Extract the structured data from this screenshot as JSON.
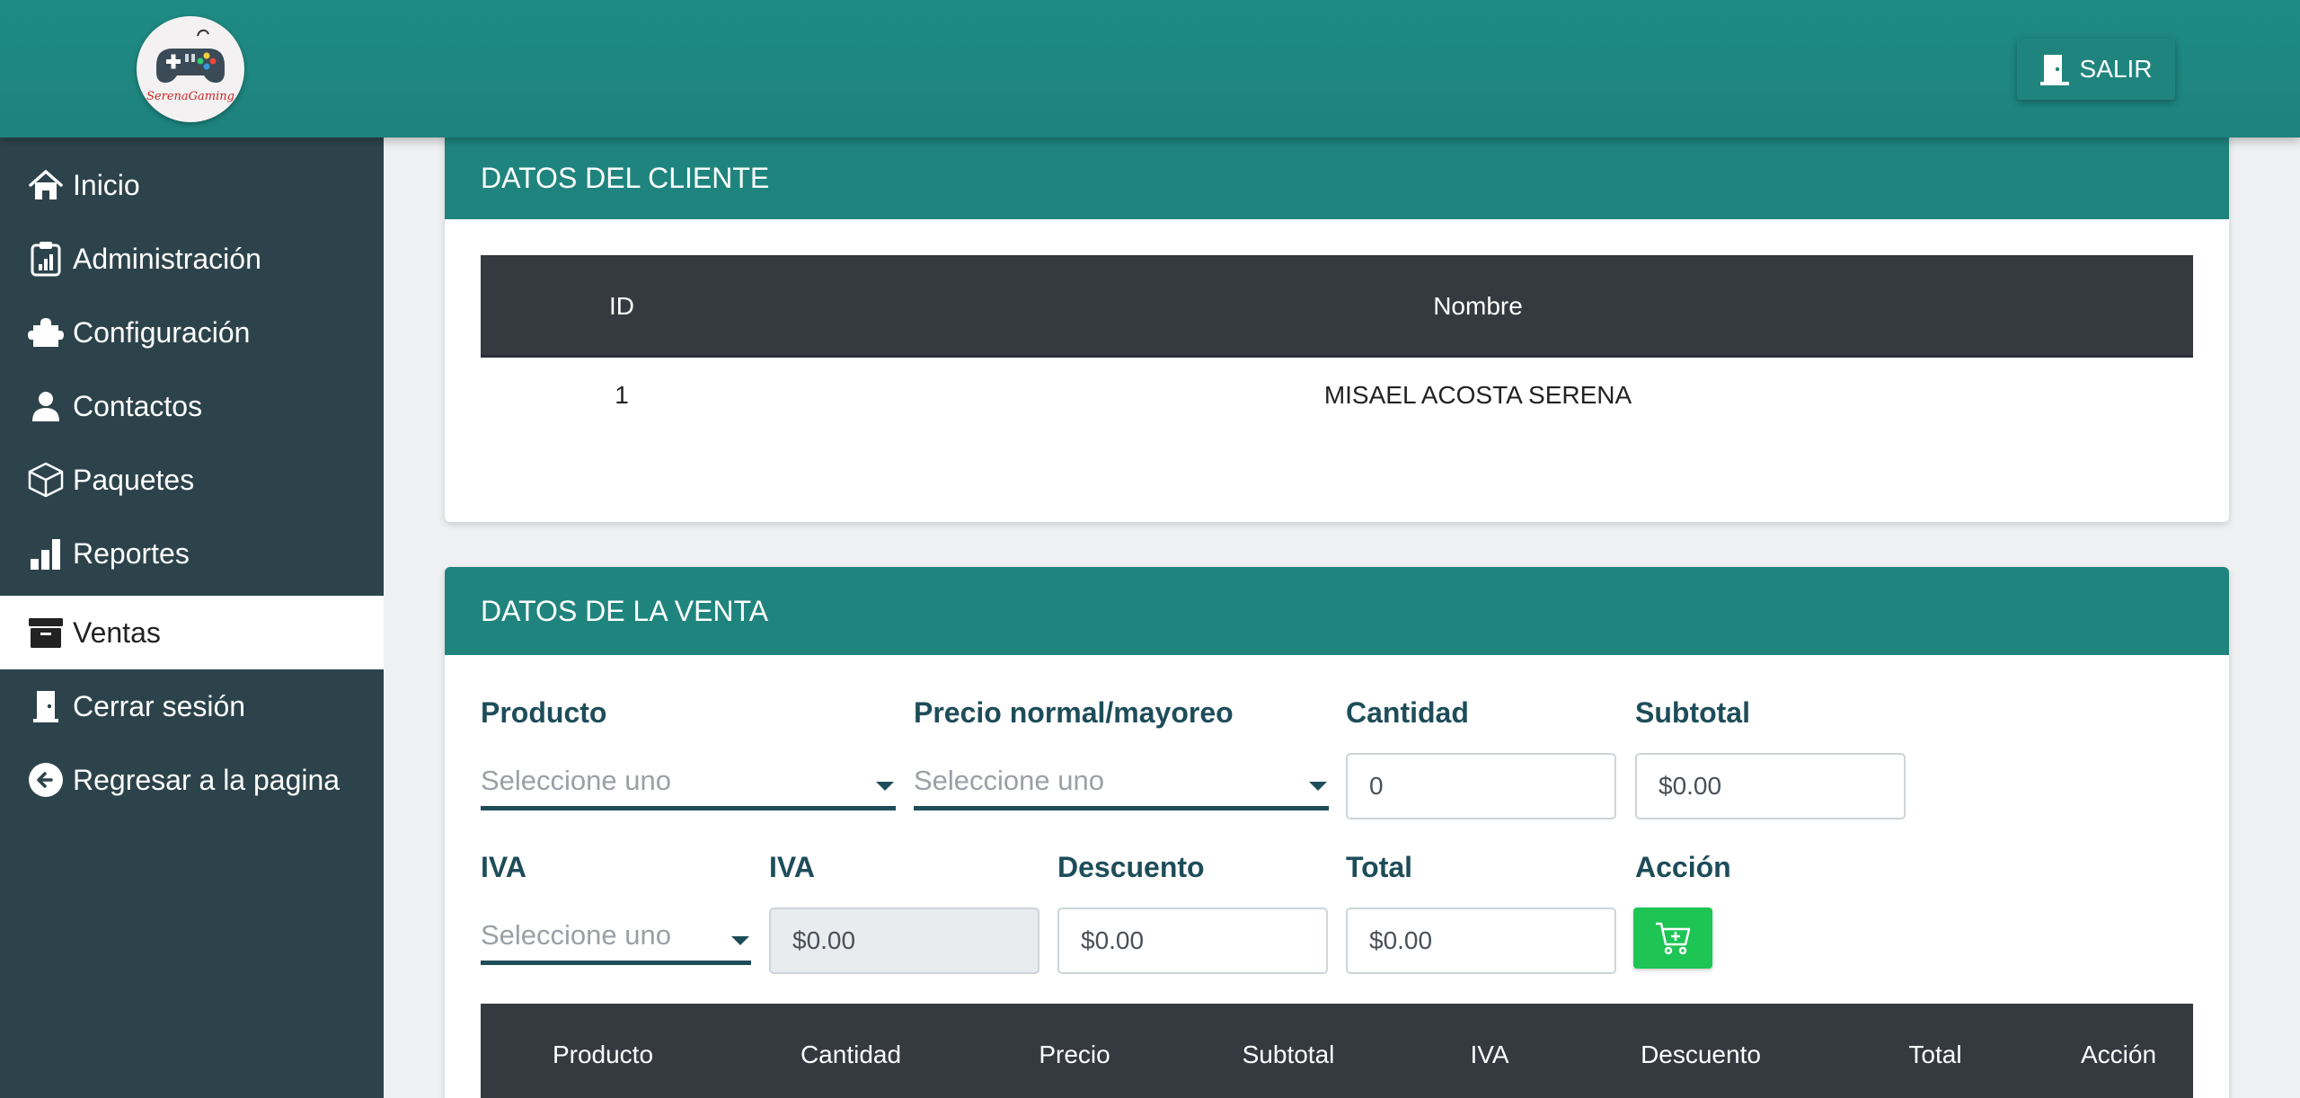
{
  "header": {
    "logo_text": "SerenaGaming",
    "exit_label": "SALIR"
  },
  "sidebar": {
    "items": [
      {
        "label": "Inicio",
        "icon": "home-icon"
      },
      {
        "label": "Administración",
        "icon": "clipboard-chart-icon"
      },
      {
        "label": "Configuración",
        "icon": "puzzle-icon"
      },
      {
        "label": "Contactos",
        "icon": "user-icon"
      },
      {
        "label": "Paquetes",
        "icon": "box-icon"
      },
      {
        "label": "Reportes",
        "icon": "bar-chart-icon"
      },
      {
        "label": "Ventas",
        "icon": "archive-icon",
        "active": true
      },
      {
        "label": "Cerrar sesión",
        "icon": "door-icon"
      },
      {
        "label": "Regresar a la pagina",
        "icon": "arrow-left-circle-icon"
      }
    ]
  },
  "client_card": {
    "title": "DATOS DEL CLIENTE",
    "columns": [
      "ID",
      "Nombre"
    ],
    "rows": [
      [
        "1",
        "MISAEL ACOSTA SERENA"
      ]
    ]
  },
  "sale_card": {
    "title": "DATOS DE LA VENTA",
    "labels": {
      "producto": "Producto",
      "precio": "Precio normal/mayoreo",
      "cantidad": "Cantidad",
      "subtotal": "Subtotal",
      "iva_select": "IVA",
      "iva_value": "IVA",
      "descuento": "Descuento",
      "total": "Total",
      "accion": "Acción"
    },
    "placeholders": {
      "producto": "Seleccione uno",
      "precio": "Seleccione uno",
      "iva": "Seleccione uno"
    },
    "values": {
      "cantidad": "0",
      "subtotal": "$0.00",
      "iva": "$0.00",
      "descuento": "$0.00",
      "total": "$0.00"
    },
    "table_columns": [
      "Producto",
      "Cantidad",
      "Precio",
      "Subtotal",
      "IVA",
      "Descuento",
      "Total",
      "Acción"
    ]
  },
  "colors": {
    "primary": "#20847e",
    "sidebar": "#2d434b",
    "table_head": "#343a40",
    "label": "#1e4d5a",
    "action_green": "#1ec454"
  }
}
